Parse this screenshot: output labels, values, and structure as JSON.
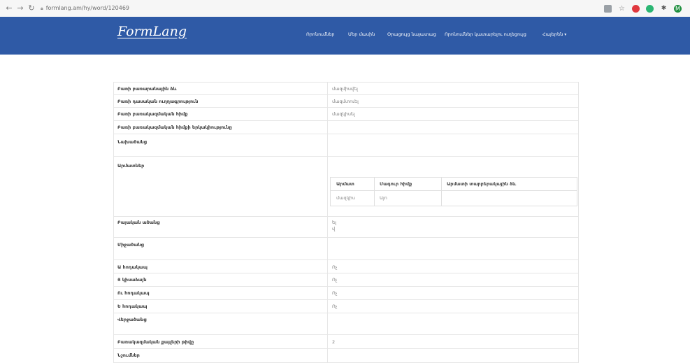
{
  "browser": {
    "url": "formlang.am/hy/word/120469"
  },
  "header": {
    "logo": "FormLang",
    "menu": [
      {
        "label": "Որոնումներ"
      },
      {
        "label": "Մեր մասին"
      },
      {
        "label": "Օրացույց նայատաց"
      },
      {
        "label": "Որոնումներ կատարելու ուղեցույց"
      },
      {
        "label": "Հայերեն"
      }
    ]
  },
  "table": {
    "rows": [
      {
        "label": "Բառի բառարանային ձև",
        "value": "մազմիսվել"
      },
      {
        "label": "Բառի դասական ուղղագրություն",
        "value": "մազմտուել"
      },
      {
        "label": "Բառի բառակազմական հիմք",
        "value": "մազկիսել"
      },
      {
        "label": "Բառի բառակազմական հիմքի երկակիությունը",
        "value": ""
      },
      {
        "label": "Նախածանց",
        "value": ""
      },
      {
        "label": "Արմատներ",
        "value": ""
      },
      {
        "label": "Բայական ածանց",
        "value": "ել\nվ"
      },
      {
        "label": "Միջածանց",
        "value": ""
      },
      {
        "label": "Ա հոդակապ",
        "value": "Ոչ"
      },
      {
        "label": "Յ կիսաձայն",
        "value": "Ոչ"
      },
      {
        "label": "Ու հոդակապ",
        "value": "Ոչ"
      },
      {
        "label": "Ե հոդակապ",
        "value": "Ոչ"
      },
      {
        "label": "Վերջածանց",
        "value": ""
      },
      {
        "label": "Բառակազմական քայլերի թիվը",
        "value": "2"
      },
      {
        "label": "Նշումներ",
        "value": ""
      }
    ],
    "roots": {
      "headers": [
        "Արմատ",
        "Մագուր հիմք",
        "Արմատի տարբերակային ձև"
      ],
      "rows": [
        [
          "մազկիս",
          "Այո",
          ""
        ]
      ]
    }
  }
}
